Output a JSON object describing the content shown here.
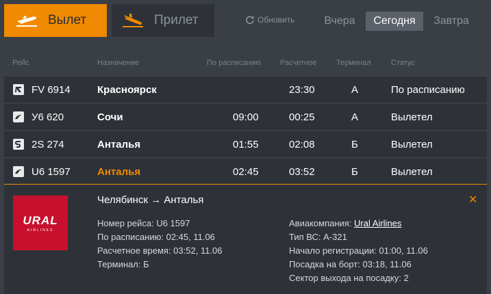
{
  "tabs": {
    "departures": "Вылет",
    "arrivals": "Прилет"
  },
  "refresh_label": "Обновить",
  "days": {
    "yesterday": "Вчера",
    "today": "Сегодня",
    "tomorrow": "Завтра"
  },
  "columns": {
    "flight": "Рейс",
    "destination": "Назначение",
    "scheduled": "По расписанию",
    "estimated": "Расчетное",
    "terminal": "Терминал",
    "status": "Статус"
  },
  "rows": [
    {
      "icon": "nordwind-airline-icon",
      "flight": "FV 6914",
      "destination": "Красноярск",
      "scheduled": "",
      "estimated": "23:30",
      "terminal": "А",
      "status": "По расписанию"
    },
    {
      "icon": "ural-airline-icon",
      "flight": "У6 620",
      "destination": "Сочи",
      "scheduled": "09:00",
      "estimated": "00:25",
      "terminal": "А",
      "status": "Вылетел"
    },
    {
      "icon": "s7-airline-icon",
      "flight": "2S 274",
      "destination": "Анталья",
      "scheduled": "01:55",
      "estimated": "02:08",
      "terminal": "Б",
      "status": "Вылетел"
    },
    {
      "icon": "ural-airline-icon",
      "flight": "U6 1597",
      "destination": "Анталья",
      "scheduled": "02:45",
      "estimated": "03:52",
      "terminal": "Б",
      "status": "Вылетел"
    }
  ],
  "detail": {
    "route": "Челябинск → Анталья",
    "logo_text": "URAL",
    "logo_subtext": "AIRLINES",
    "flight_number_label": "Номер рейса: ",
    "flight_number": "U6 1597",
    "scheduled_label": "По расписанию: ",
    "scheduled": "02:45, 11.06",
    "estimated_label": "Расчетное время: ",
    "estimated": "03:52, 11.06",
    "terminal_label": "Терминал: ",
    "terminal": "Б",
    "airline_label": "Авиакомпания: ",
    "airline": "Ural Airlines",
    "aircraft_label": "Тип ВС: ",
    "aircraft": "А-321",
    "checkin_label": "Начало регистрации: ",
    "checkin": "01:00, 11.06",
    "boarding_label": "Посадка на борт: ",
    "boarding": "03:18, 11.06",
    "gate_label": "Сектор выхода на посадку: ",
    "gate": "2"
  },
  "colors": {
    "accent": "#f08a00",
    "background": "#3a3f46",
    "row": "#2e3238",
    "logo": "#c8102e"
  }
}
